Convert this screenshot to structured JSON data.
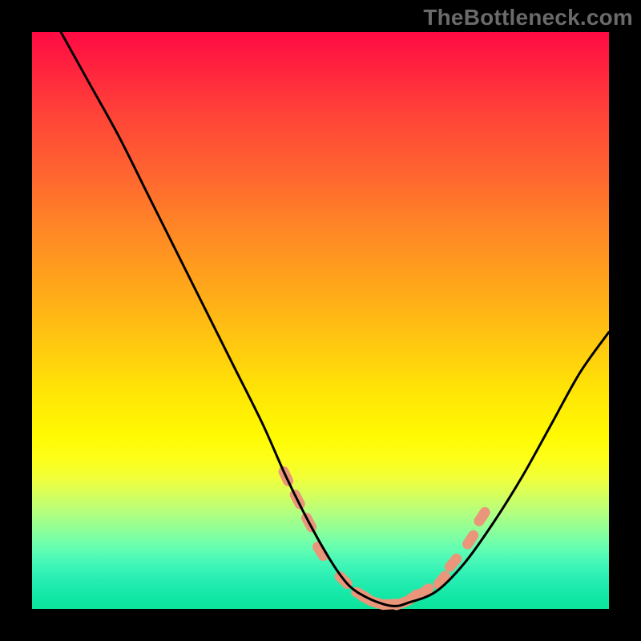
{
  "watermark": "TheBottleneck.com",
  "chart_data": {
    "type": "line",
    "title": "",
    "xlabel": "",
    "ylabel": "",
    "xlim": [
      0,
      100
    ],
    "ylim": [
      0,
      100
    ],
    "grid": false,
    "background": "vertical_heat_gradient",
    "series": [
      {
        "name": "curve",
        "color": "#000000",
        "x": [
          5,
          10,
          15,
          20,
          25,
          30,
          35,
          40,
          44,
          48,
          52,
          55,
          58,
          61,
          63,
          65,
          70,
          75,
          80,
          85,
          90,
          95,
          100
        ],
        "y": [
          100,
          91,
          82,
          72,
          62,
          52,
          42,
          32,
          23,
          15,
          8,
          4,
          2,
          0.8,
          0.5,
          1,
          3,
          8,
          15,
          23,
          32,
          41,
          48
        ]
      },
      {
        "name": "marker_band",
        "color": "#e9967a",
        "marker": "rounded_bar",
        "x": [
          44,
          46,
          48,
          50,
          54,
          57,
          58,
          60,
          62,
          64,
          66,
          68,
          71,
          73,
          76,
          78
        ],
        "y": [
          23,
          19,
          15,
          10,
          5,
          2.5,
          1.8,
          1,
          0.8,
          1,
          2,
          3,
          5,
          8,
          12,
          16
        ]
      }
    ]
  },
  "colors": {
    "background_black": "#000000",
    "curve": "#000000",
    "marker": "#e9967a",
    "watermark": "#6a6a6a"
  }
}
